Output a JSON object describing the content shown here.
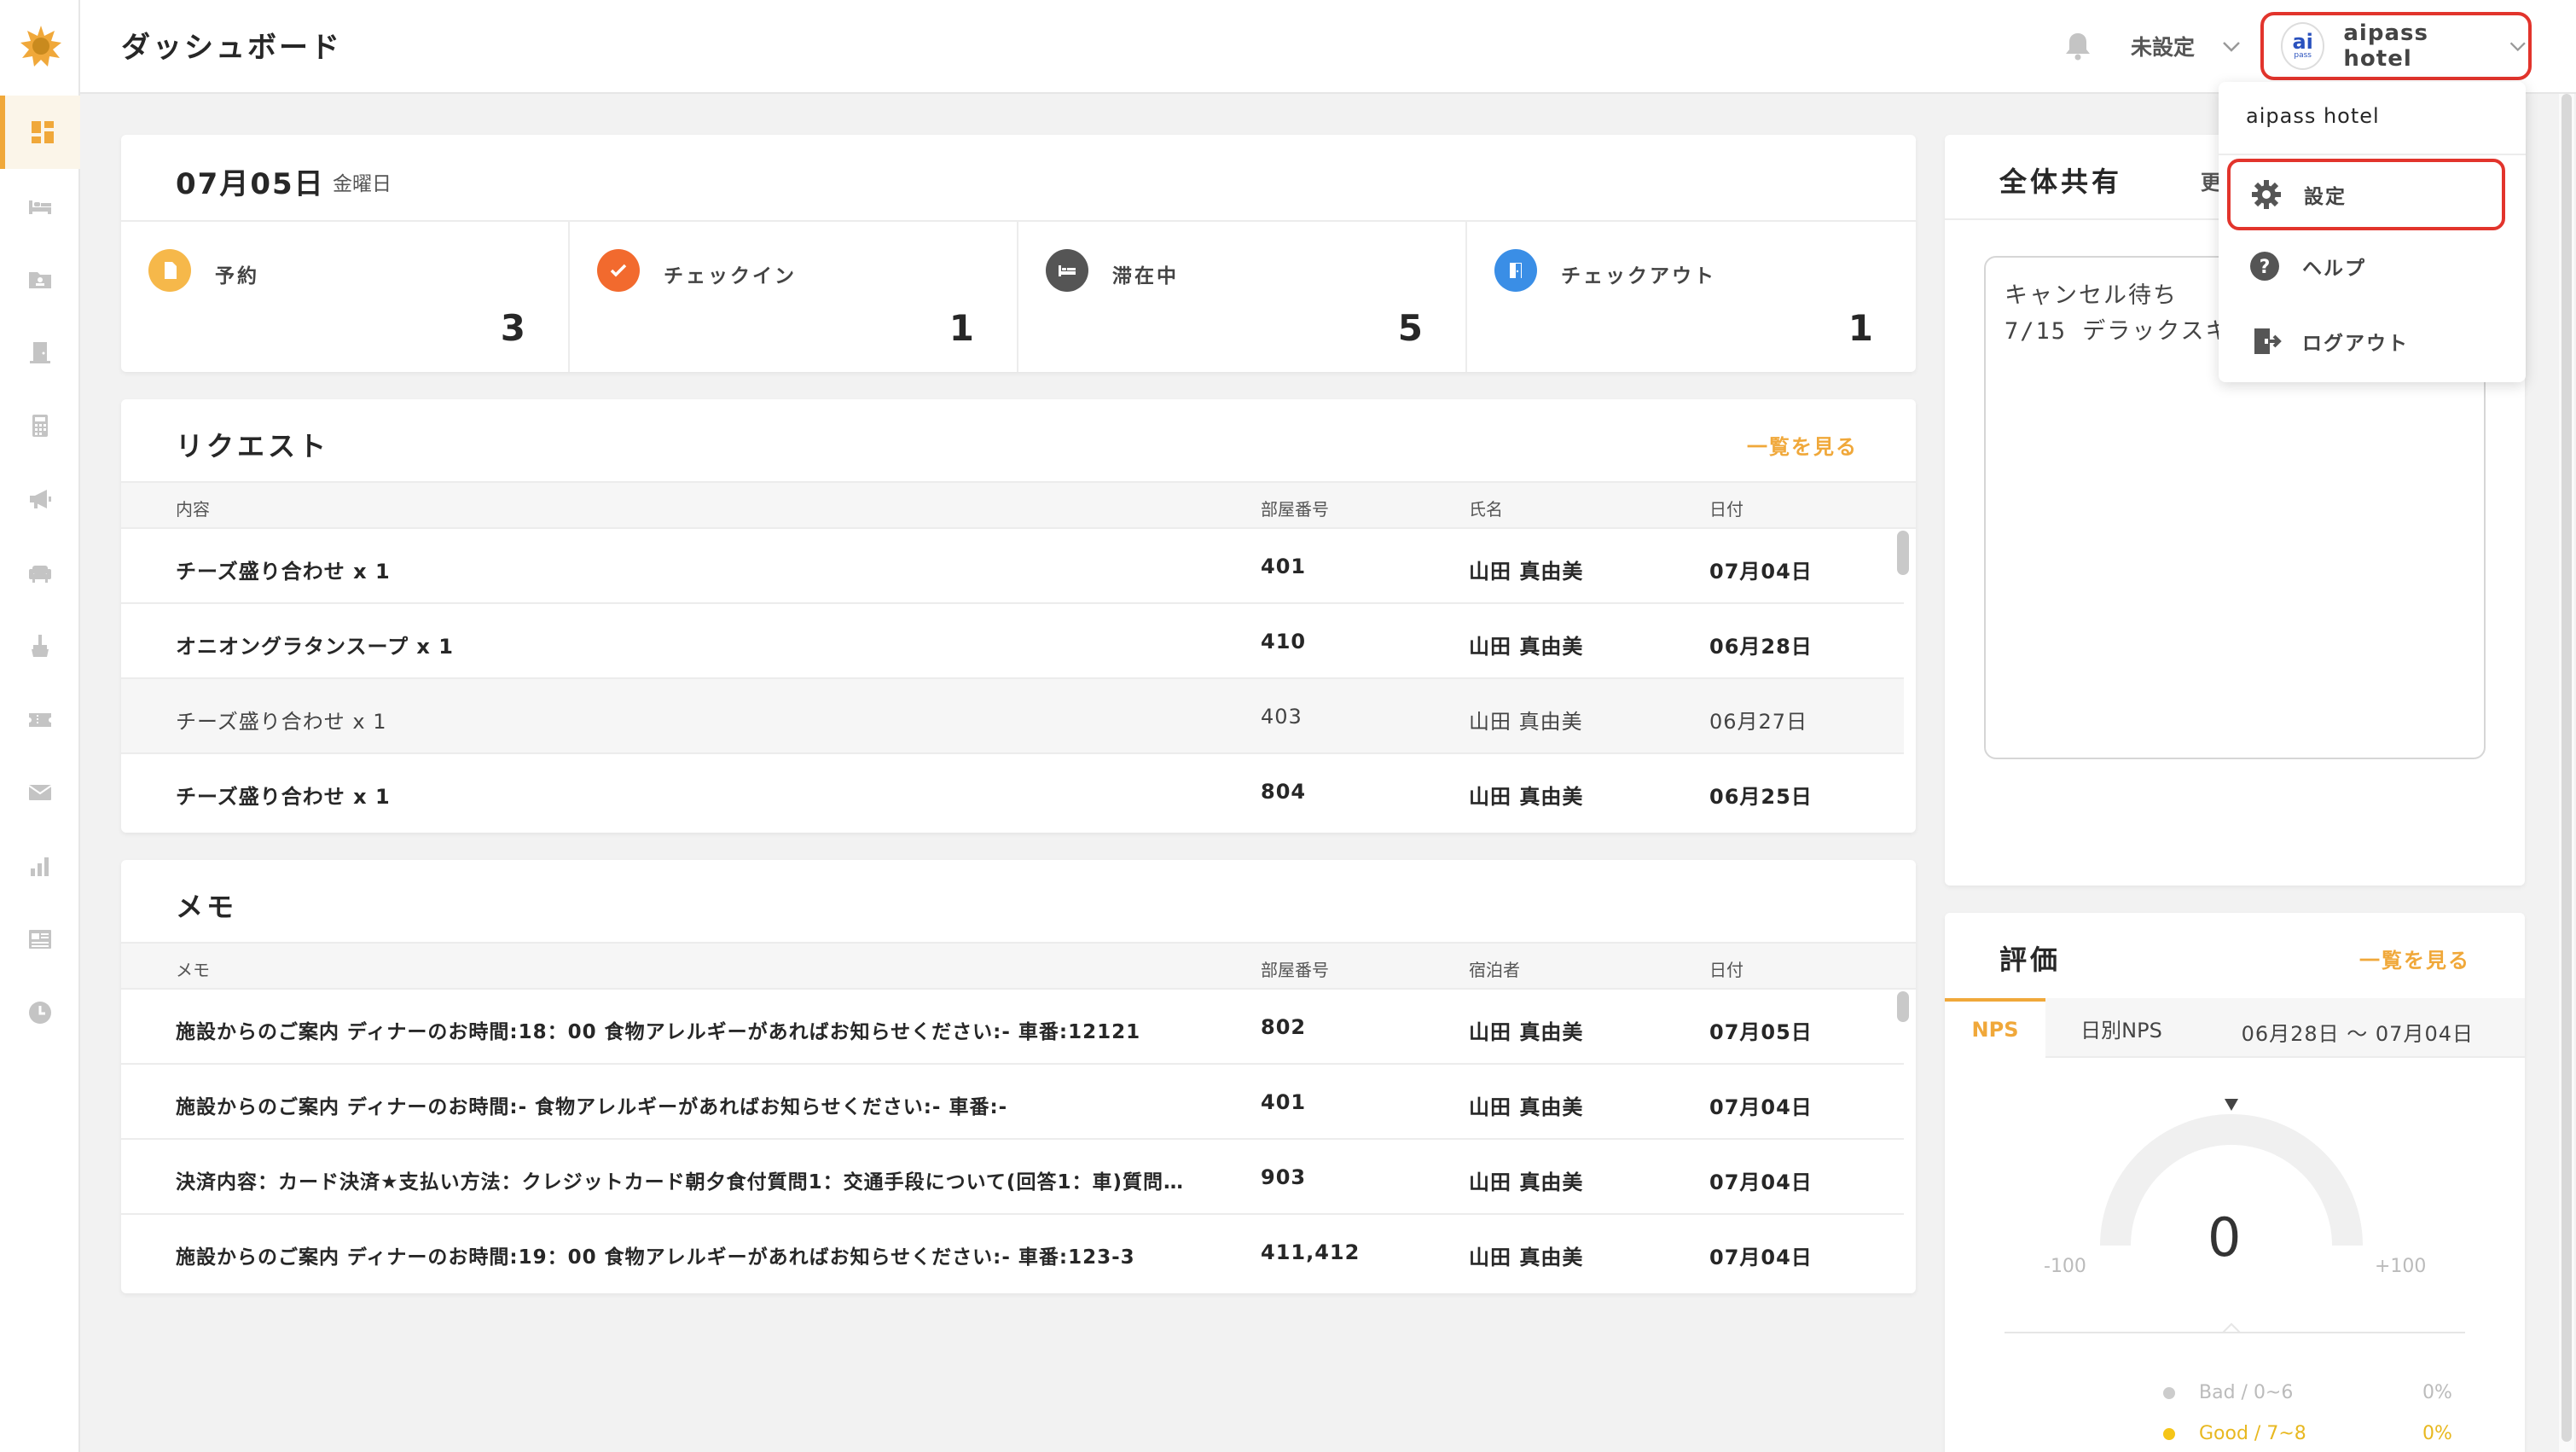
{
  "colors": {
    "accent": "#f0a83a",
    "highlight": "#e2342c",
    "checkin": "#f26a2e",
    "checkout": "#3a8ee6",
    "stay": "#555555"
  },
  "header": {
    "title": "ダッシュボード",
    "status_select": "未設定",
    "hotel_name": "aipass hotel",
    "avatar_ai": "ai",
    "avatar_pass": "pass"
  },
  "sidebar": {
    "items": [
      {
        "icon": "dashboard-icon",
        "active": true
      },
      {
        "icon": "bed-icon"
      },
      {
        "icon": "guest-folder-icon"
      },
      {
        "icon": "door-icon"
      },
      {
        "icon": "calculator-icon"
      },
      {
        "icon": "megaphone-icon"
      },
      {
        "icon": "lounge-chair-icon"
      },
      {
        "icon": "cleaning-icon"
      },
      {
        "icon": "ticket-icon"
      },
      {
        "icon": "mail-icon"
      },
      {
        "icon": "bar-chart-icon"
      },
      {
        "icon": "news-icon"
      },
      {
        "icon": "clock-icon"
      }
    ]
  },
  "summary": {
    "date": "07月05日",
    "weekday": "金曜日",
    "stats": [
      {
        "label": "予約",
        "value": "3",
        "icon": "reservation-icon"
      },
      {
        "label": "チェックイン",
        "value": "1",
        "icon": "checkin-icon"
      },
      {
        "label": "滞在中",
        "value": "5",
        "icon": "staying-icon"
      },
      {
        "label": "チェックアウト",
        "value": "1",
        "icon": "checkout-icon"
      }
    ]
  },
  "requests": {
    "title": "リクエスト",
    "see_all": "一覧を見る",
    "columns": [
      "内容",
      "部屋番号",
      "氏名",
      "日付"
    ],
    "rows": [
      {
        "content": "チーズ盛り合わせ x 1",
        "room": "401",
        "name": "山田 真由美",
        "date": "07月04日"
      },
      {
        "content": "オニオングラタンスープ x 1",
        "room": "410",
        "name": "山田 真由美",
        "date": "06月28日"
      },
      {
        "content": "チーズ盛り合わせ x 1",
        "room": "403",
        "name": "山田 真由美",
        "date": "06月27日"
      },
      {
        "content": "チーズ盛り合わせ x 1",
        "room": "804",
        "name": "山田 真由美",
        "date": "06月25日"
      }
    ]
  },
  "memo": {
    "title": "メモ",
    "columns": [
      "メモ",
      "部屋番号",
      "宿泊者",
      "日付"
    ],
    "rows": [
      {
        "content": "施設からのご案内 ディナーのお時間:18：00 食物アレルギーがあればお知らせください:- 車番:12121",
        "room": "802",
        "name": "山田 真由美",
        "date": "07月05日"
      },
      {
        "content": "施設からのご案内 ディナーのお時間:- 食物アレルギーがあればお知らせください:- 車番:-",
        "room": "401",
        "name": "山田 真由美",
        "date": "07月04日"
      },
      {
        "content": "決済内容：カード決済★支払い方法：クレジットカード朝夕食付質問1：交通手段について(回答1：車)質問…",
        "room": "903",
        "name": "山田 真由美",
        "date": "07月04日"
      },
      {
        "content": "施設からのご案内 ディナーのお時間:19：00 食物アレルギーがあればお知らせください:- 車番:123-3",
        "room": "411,412",
        "name": "山田 真由美",
        "date": "07月04日"
      }
    ]
  },
  "share": {
    "title": "全体共有",
    "update_label": "更",
    "text": "キャンセル待ち\n7/15 デラックスキ"
  },
  "rating": {
    "title": "評価",
    "see_all": "一覧を見る",
    "tabs": [
      "NPS",
      "日別NPS"
    ],
    "date_range": "06月28日 〜 07月04日",
    "nps_value": "0",
    "gauge_min": "-100",
    "gauge_max": "+100",
    "legend": [
      {
        "label": "Bad / 0~6",
        "pct": "0%",
        "color": "#cccccc"
      },
      {
        "label": "Good / 7~8",
        "pct": "0%",
        "color": "#f5c518"
      }
    ]
  },
  "account_menu": {
    "hotel_name": "aipass hotel",
    "items": [
      {
        "label": "設定",
        "icon": "gear-icon"
      },
      {
        "label": "ヘルプ",
        "icon": "help-icon"
      },
      {
        "label": "ログアウト",
        "icon": "logout-icon"
      }
    ]
  }
}
